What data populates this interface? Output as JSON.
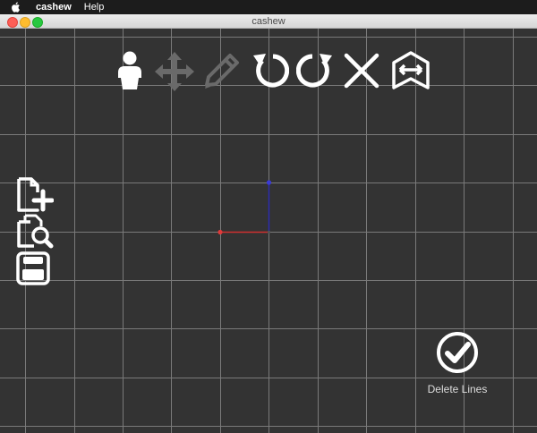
{
  "menubar": {
    "app_name": "cashew",
    "help_label": "Help"
  },
  "window": {
    "title": "cashew"
  },
  "toolbar": {
    "tools": [
      "person-icon",
      "move-icon",
      "pencil-icon",
      "rotate-left-icon",
      "rotate-right-icon",
      "close-x-icon",
      "flip-icon"
    ]
  },
  "sidebar": {
    "tools": [
      "new-file-icon",
      "search-file-icon",
      "save-icon"
    ]
  },
  "delete_lines": {
    "label": "Delete Lines"
  },
  "colors": {
    "canvas_bg": "#333333",
    "grid_line": "#7a7a7a",
    "axis_x": "#d03030",
    "axis_y": "#2d2db0",
    "icon_active": "#ffffff",
    "icon_disabled": "#6a6a6a"
  }
}
